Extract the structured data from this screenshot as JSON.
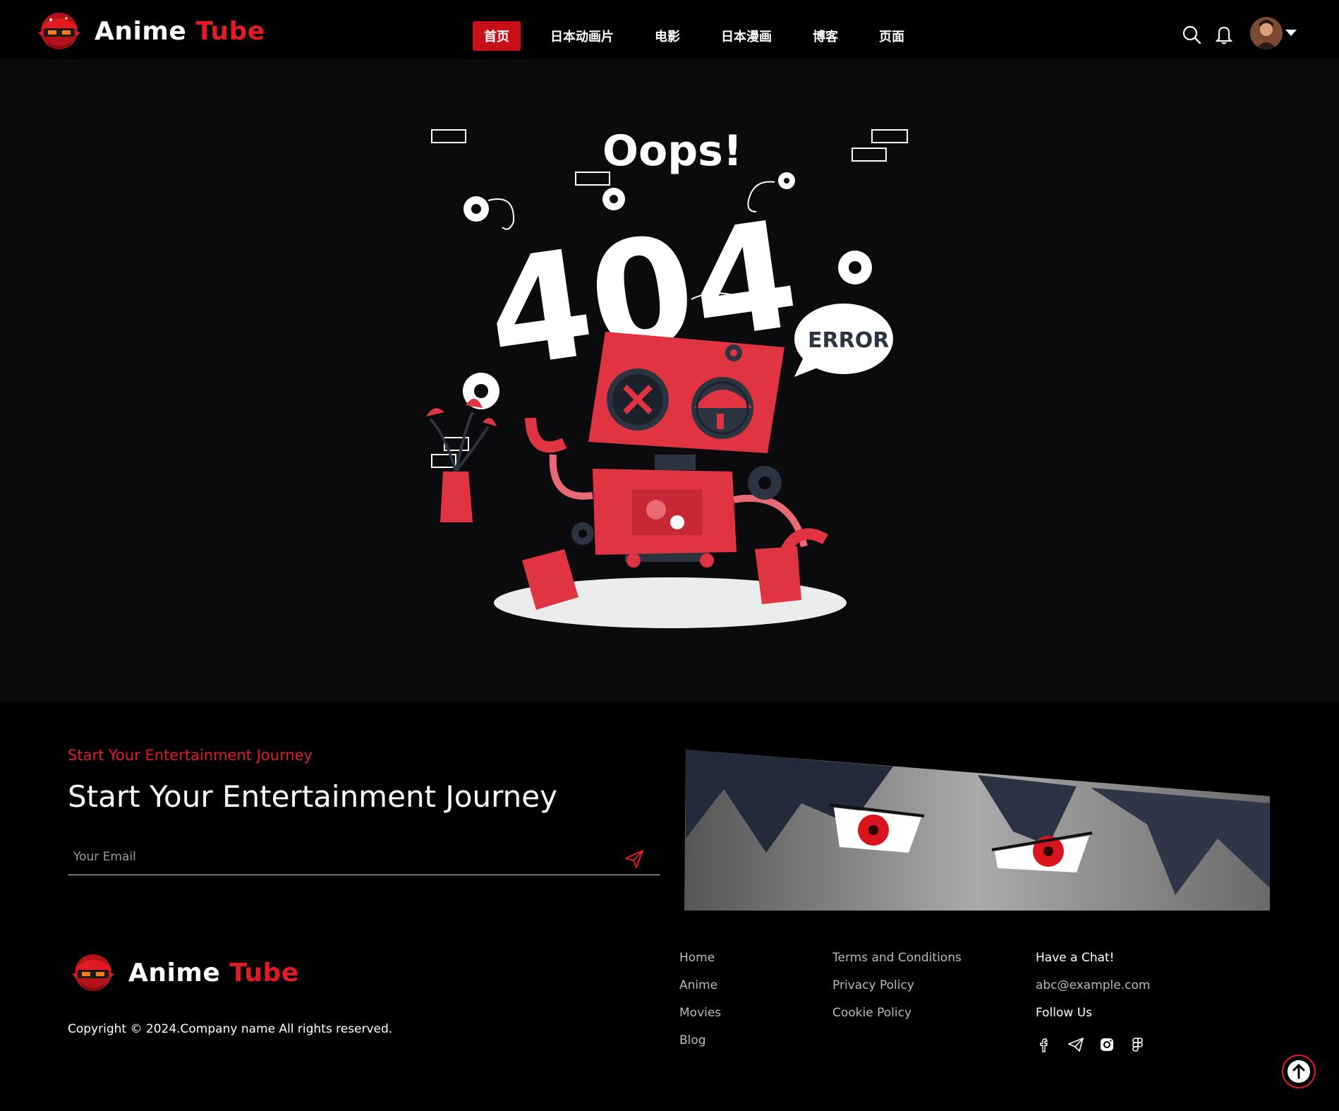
{
  "header": {
    "logo": {
      "name_a": "Anime",
      "name_b": "Tube"
    },
    "nav": [
      {
        "label": "首页",
        "active": true
      },
      {
        "label": "日本动画片",
        "active": false
      },
      {
        "label": "电影",
        "active": false
      },
      {
        "label": "日本漫画",
        "active": false
      },
      {
        "label": "博客",
        "active": false
      },
      {
        "label": "页面",
        "active": false
      }
    ],
    "icons": [
      "search-icon",
      "bell-icon",
      "avatar",
      "chevron-down-icon"
    ]
  },
  "error_art": {
    "oops": "Oops!",
    "code": "404",
    "bubble": "ERROR"
  },
  "footer": {
    "eyebrow": "Start Your Entertainment Journey",
    "headline": "Start Your Entertainment Journey",
    "email_placeholder": "Your Email",
    "logo": {
      "name_a": "Anime",
      "name_b": "Tube"
    },
    "copyright": "Copyright © 2024.Company name All rights reserved.",
    "links_col1": [
      "Home",
      "Anime",
      "Movies",
      "Blog"
    ],
    "links_col2": [
      "Terms and Conditions",
      "Privacy Policy",
      "Cookie Policy"
    ],
    "chat_title": "Have a Chat!",
    "email": "abc@example.com",
    "follow_title": "Follow Us",
    "socials": [
      "facebook-icon",
      "telegram-icon",
      "instagram-icon",
      "figma-icon"
    ]
  },
  "colors": {
    "accent": "#e21a22",
    "nav_active": "#c8101a",
    "bg_main": "#0b0b0e",
    "bg_footer": "#000000"
  }
}
